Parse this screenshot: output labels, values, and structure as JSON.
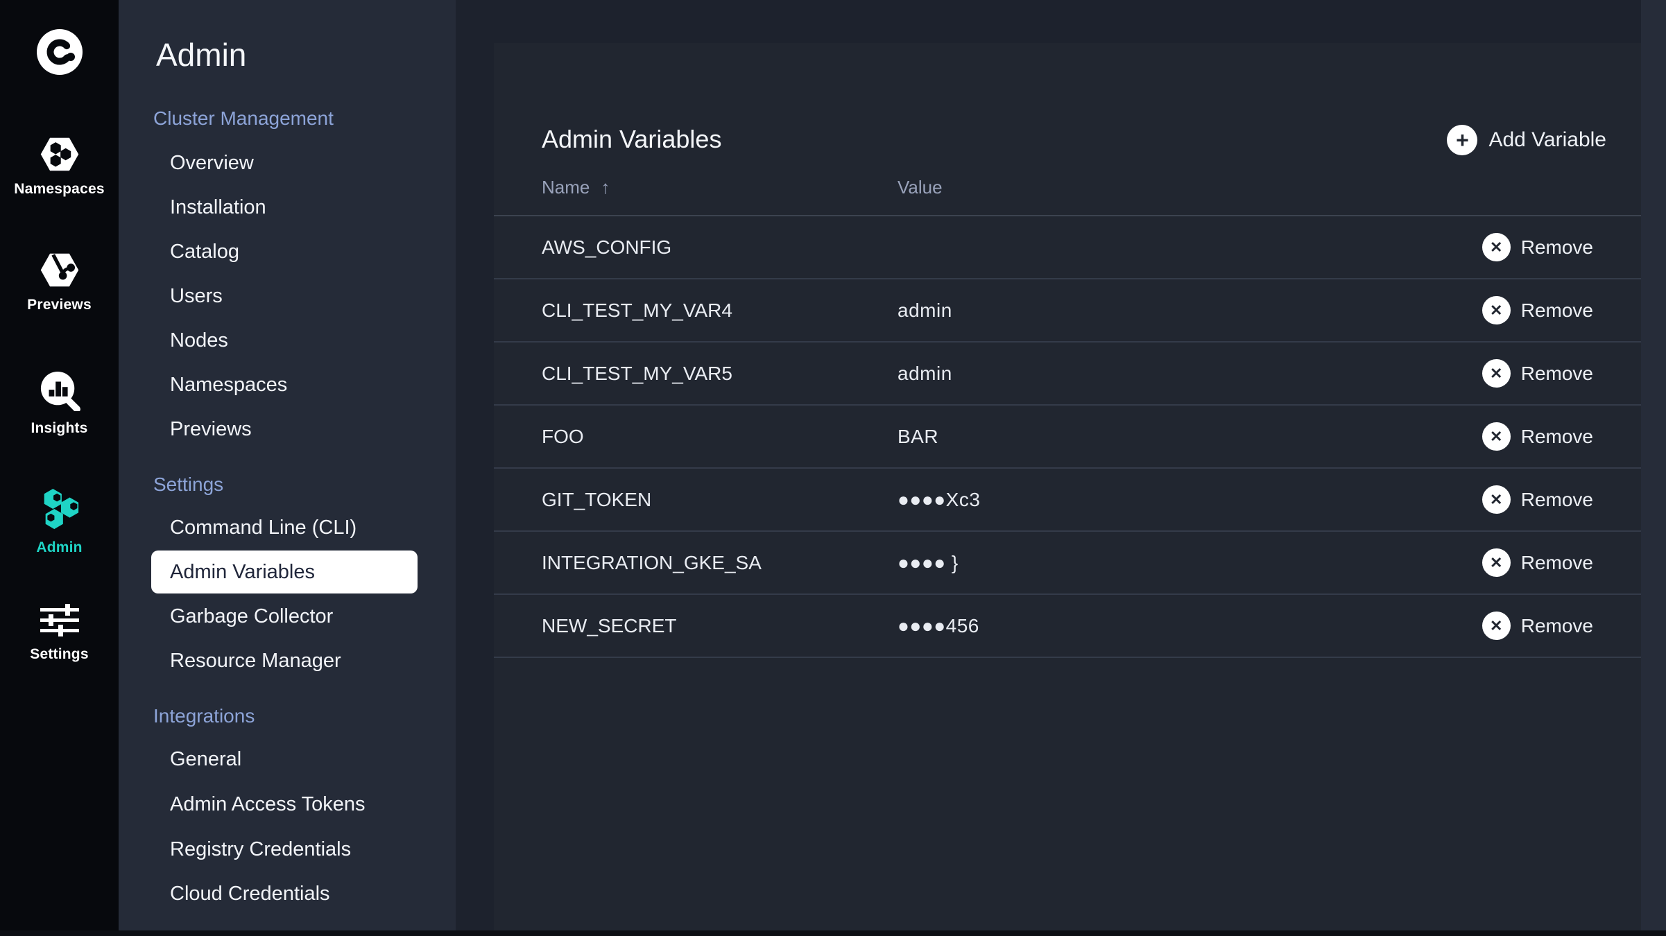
{
  "colors": {
    "rail_bg": "#07090d",
    "sidebar_bg": "#252b38",
    "main_bg": "#1d222d",
    "card_bg": "#212630",
    "accent_teal": "#1fd4c5",
    "section_header": "#8da4d8",
    "selected_pill": "#ffffff"
  },
  "rail": {
    "logo_icon": "okteto-logo",
    "items": [
      {
        "label": "Namespaces",
        "icon": "namespaces-hexagons-icon",
        "active": false
      },
      {
        "label": "Previews",
        "icon": "previews-git-hexagon-icon",
        "active": false
      },
      {
        "label": "Insights",
        "icon": "insights-chart-magnifier-icon",
        "active": false
      },
      {
        "label": "Admin",
        "icon": "admin-hexagons-icon",
        "active": true
      },
      {
        "label": "Settings",
        "icon": "settings-sliders-icon",
        "active": false
      }
    ]
  },
  "sidebar": {
    "title": "Admin",
    "sections": [
      {
        "header": "Cluster Management",
        "items": [
          {
            "label": "Overview"
          },
          {
            "label": "Installation"
          },
          {
            "label": "Catalog"
          },
          {
            "label": "Users"
          },
          {
            "label": "Nodes"
          },
          {
            "label": "Namespaces"
          },
          {
            "label": "Previews"
          }
        ]
      },
      {
        "header": "Settings",
        "items": [
          {
            "label": "Command Line (CLI)"
          },
          {
            "label": "Admin Variables",
            "selected": true
          },
          {
            "label": "Garbage Collector"
          },
          {
            "label": "Resource Manager"
          }
        ]
      },
      {
        "header": "Integrations",
        "items": [
          {
            "label": "General"
          },
          {
            "label": "Admin Access Tokens"
          },
          {
            "label": "Registry Credentials"
          },
          {
            "label": "Cloud Credentials"
          }
        ]
      }
    ]
  },
  "main": {
    "card": {
      "title": "Admin Variables",
      "add_button": {
        "label": "Add Variable",
        "icon": "plus-icon"
      },
      "table": {
        "columns": [
          "Name",
          "Value"
        ],
        "sort": {
          "column": "Name",
          "direction": "ascending",
          "icon": "sort-ascending-arrow-icon",
          "glyph": "↑"
        },
        "rows": [
          {
            "name": "AWS_CONFIG",
            "value": "",
            "action": "Remove"
          },
          {
            "name": "CLI_TEST_MY_VAR4",
            "value": "admin",
            "action": "Remove"
          },
          {
            "name": "CLI_TEST_MY_VAR5",
            "value": "admin",
            "action": "Remove"
          },
          {
            "name": "FOO",
            "value": "BAR",
            "action": "Remove"
          },
          {
            "name": "GIT_TOKEN",
            "value": "●●●●Xc3",
            "action": "Remove"
          },
          {
            "name": "INTEGRATION_GKE_SA",
            "value": "●●●● }",
            "action": "Remove"
          },
          {
            "name": "NEW_SECRET",
            "value": "●●●●456",
            "action": "Remove"
          }
        ]
      }
    }
  }
}
